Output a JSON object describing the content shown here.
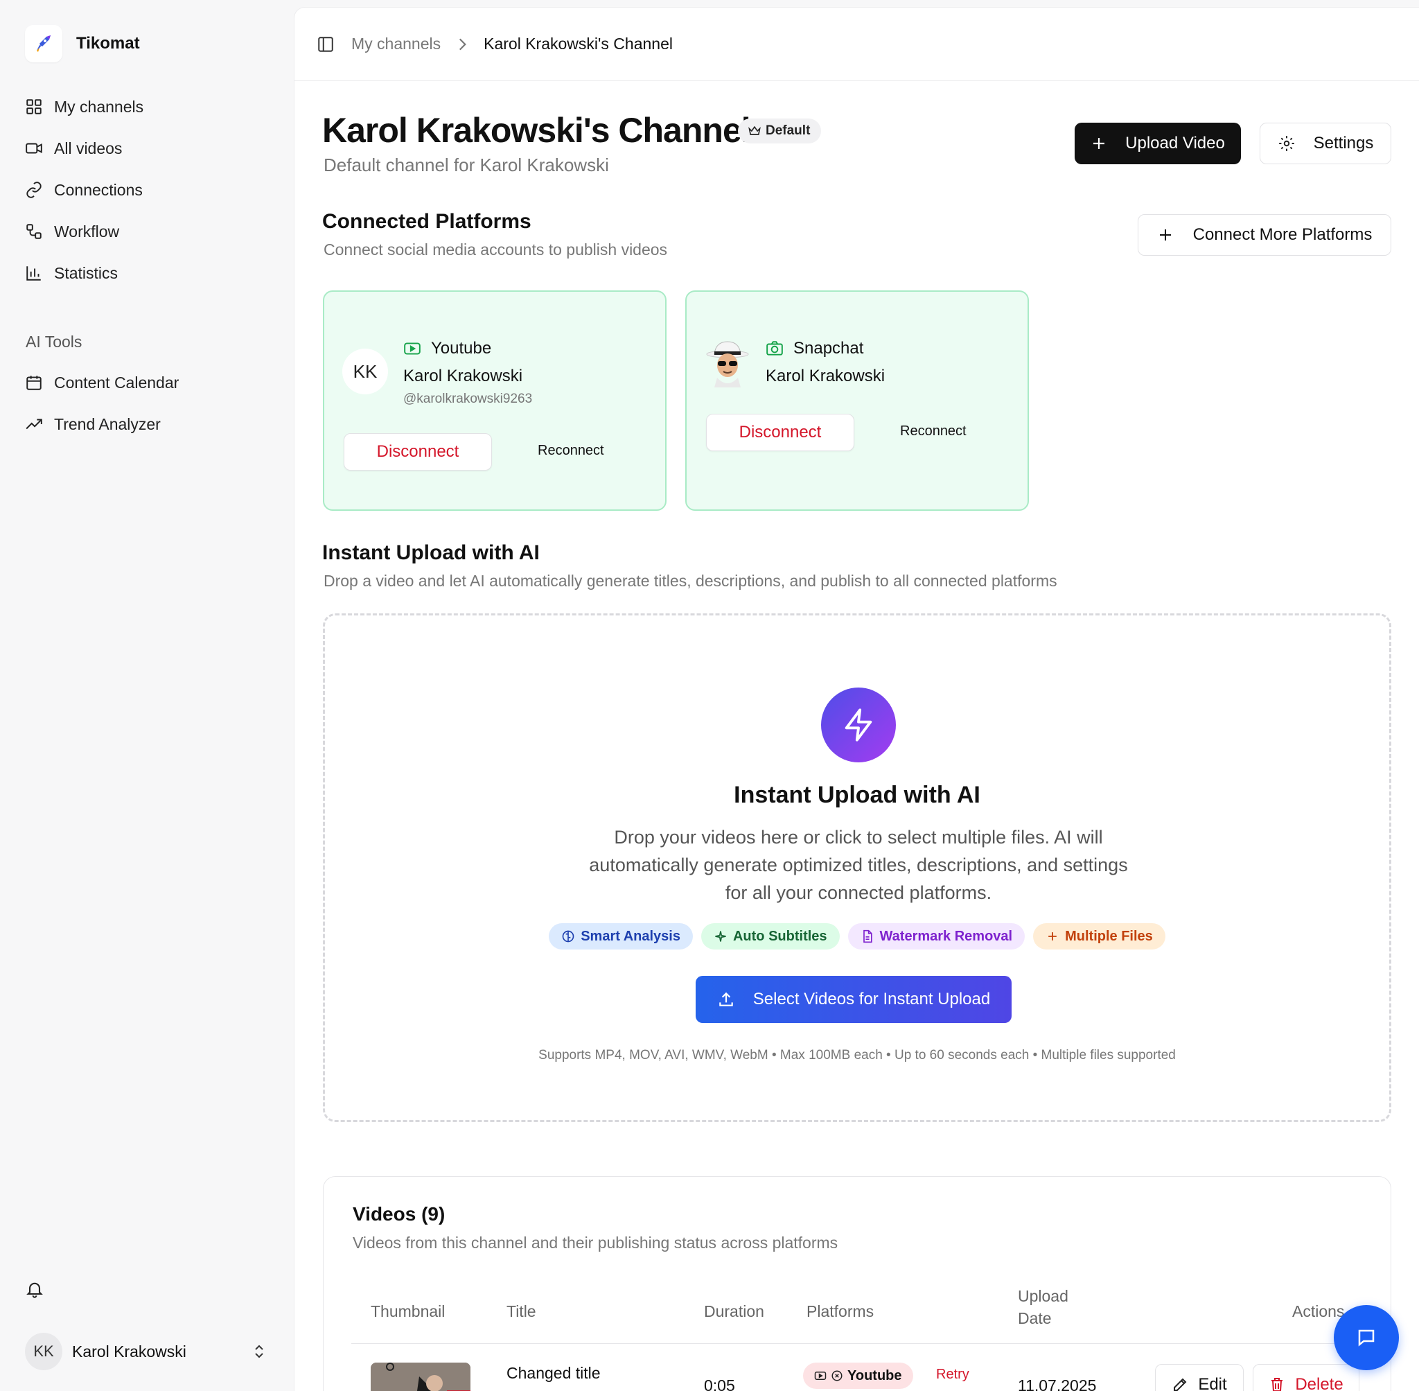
{
  "app": {
    "name": "Tikomat"
  },
  "sidebar": {
    "items": [
      {
        "label": "My channels",
        "icon": "grid-icon"
      },
      {
        "label": "All videos",
        "icon": "video-icon"
      },
      {
        "label": "Connections",
        "icon": "link-icon"
      },
      {
        "label": "Workflow",
        "icon": "workflow-icon"
      },
      {
        "label": "Statistics",
        "icon": "bar-chart-icon"
      }
    ],
    "section_label": "AI Tools",
    "ai_items": [
      {
        "label": "Content Calendar",
        "icon": "calendar-icon"
      },
      {
        "label": "Trend Analyzer",
        "icon": "trending-up-icon"
      }
    ],
    "user": {
      "initials": "KK",
      "name": "Karol Krakowski"
    }
  },
  "breadcrumb": {
    "parent": "My channels",
    "current": "Karol Krakowski's Channel"
  },
  "channel": {
    "title": "Karol Krakowski's Channel",
    "badge": "Default",
    "subtitle": "Default channel for Karol Krakowski",
    "upload_label": "Upload Video",
    "settings_label": "Settings"
  },
  "connected": {
    "title": "Connected Platforms",
    "subtitle": "Connect social media accounts to publish videos",
    "connect_more_label": "Connect More Platforms",
    "platforms": [
      {
        "platform": "Youtube",
        "initials": "KK",
        "name": "Karol Krakowski",
        "handle": "@karolkrakowski9263",
        "disconnect": "Disconnect",
        "reconnect": "Reconnect"
      },
      {
        "platform": "Snapchat",
        "name": "Karol Krakowski",
        "disconnect": "Disconnect",
        "reconnect": "Reconnect"
      }
    ]
  },
  "instant": {
    "section_title": "Instant Upload with AI",
    "section_sub": "Drop a video and let AI automatically generate titles, descriptions, and publish to all connected platforms",
    "dz_title": "Instant Upload with AI",
    "dz_desc": "Drop your videos here or click to select multiple files. AI will automatically generate optimized titles, descriptions, and settings for all your connected platforms.",
    "features": [
      "Smart Analysis",
      "Auto Subtitles",
      "Watermark Removal",
      "Multiple Files"
    ],
    "select_label": "Select Videos for Instant Upload",
    "support": "Supports MP4, MOV, AVI, WMV, WebM • Max 100MB each • Up to 60 seconds each • Multiple files supported"
  },
  "videos": {
    "title": "Videos (9)",
    "subtitle": "Videos from this channel and their publishing status across platforms",
    "columns": [
      "Thumbnail",
      "Title",
      "Duration",
      "Platforms",
      "Upload Date",
      "Actions"
    ],
    "rows": [
      {
        "title": "Changed title",
        "duration": "0:05",
        "platform": "Youtube",
        "retry": "Retry",
        "date": "11.07.2025",
        "edit": "Edit",
        "delete": "Delete"
      }
    ]
  },
  "colors": {
    "accent": "#1a5ff5",
    "danger": "#d4162a",
    "connected_bg": "#ecfcf3",
    "connected_border": "#a9ebc6"
  }
}
